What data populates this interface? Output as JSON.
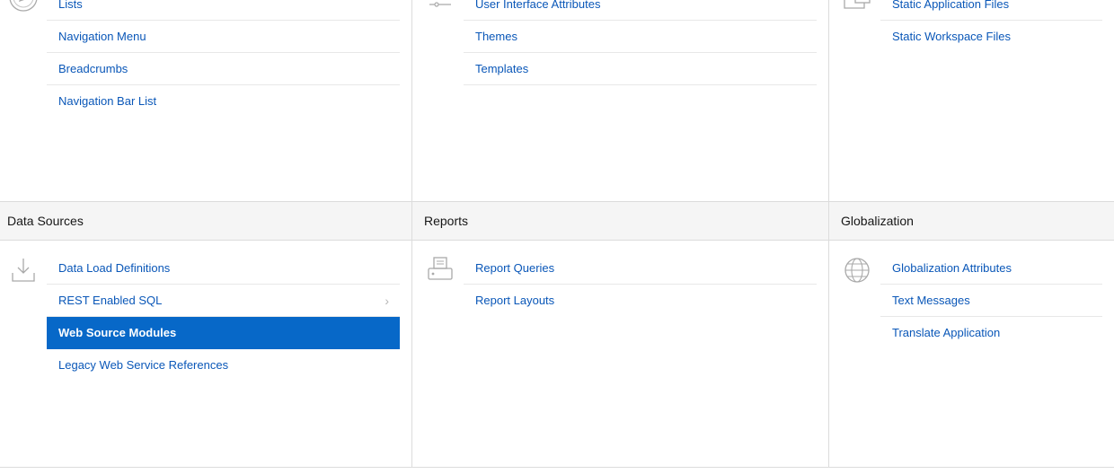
{
  "columns": [
    {
      "top": {
        "icon": "compass-icon",
        "links": [
          "Lists",
          "Navigation Menu",
          "Breadcrumbs",
          "Navigation Bar List"
        ]
      },
      "bottom": {
        "title": "Data Sources",
        "icon": "download-tray-icon",
        "links": [
          {
            "label": "Data Load Definitions"
          },
          {
            "label": "REST Enabled SQL",
            "chevron": "›"
          },
          {
            "label": "Web Source Modules",
            "selected": true
          },
          {
            "label": "Legacy Web Service References"
          }
        ]
      }
    },
    {
      "top": {
        "icon": "user-interface-icon",
        "links": [
          "User Interface Attributes",
          "Themes",
          "Templates"
        ]
      },
      "bottom": {
        "title": "Reports",
        "icon": "printer-icon",
        "links": [
          {
            "label": "Report Queries"
          },
          {
            "label": "Report Layouts"
          }
        ]
      }
    },
    {
      "top": {
        "icon": "files-icon",
        "links": [
          "Static Application Files",
          "Static Workspace Files"
        ]
      },
      "bottom": {
        "title": "Globalization",
        "icon": "globe-icon",
        "links": [
          {
            "label": "Globalization Attributes"
          },
          {
            "label": "Text Messages"
          },
          {
            "label": "Translate Application"
          }
        ]
      }
    }
  ],
  "colors": {
    "link": "#0a57b8",
    "selected_bg": "#0768c8",
    "header_bg": "#f5f5f5"
  }
}
